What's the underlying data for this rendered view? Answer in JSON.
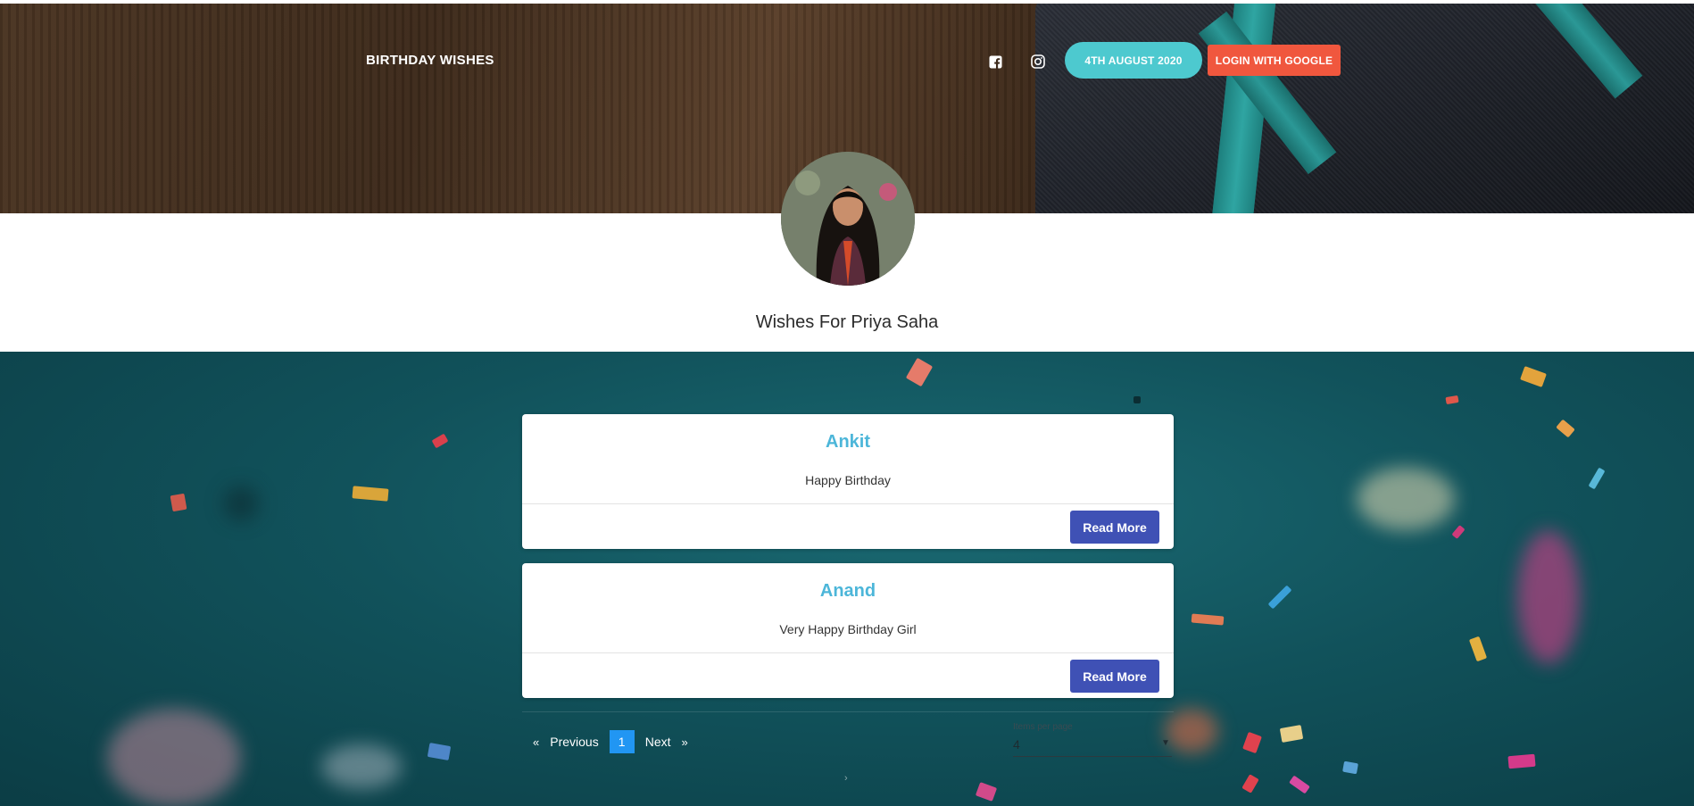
{
  "header": {
    "brand": "BIRTHDAY WISHES",
    "date": "4TH AUGUST 2020",
    "login_label": "LOGIN WITH GOOGLE",
    "icons": [
      "facebook-icon",
      "instagram-icon"
    ]
  },
  "profile": {
    "title": "Wishes For Priya Saha"
  },
  "wishes": [
    {
      "name": "Ankit",
      "message": "Happy Birthday",
      "button": "Read More"
    },
    {
      "name": "Anand",
      "message": "Very Happy Birthday Girl",
      "button": "Read More"
    }
  ],
  "pagination": {
    "prev_arrow": "«",
    "prev_label": "Previous",
    "current_page": "1",
    "next_label": "Next",
    "next_arrow": "»",
    "items_per_page_label": "Items per page",
    "items_per_page_value": "4"
  },
  "colors": {
    "date_pill": "#4dc9cf",
    "login_button": "#f0573e",
    "read_more_button": "#3f51b5",
    "wish_name": "#4cb6d9",
    "current_page": "#2196f3"
  }
}
